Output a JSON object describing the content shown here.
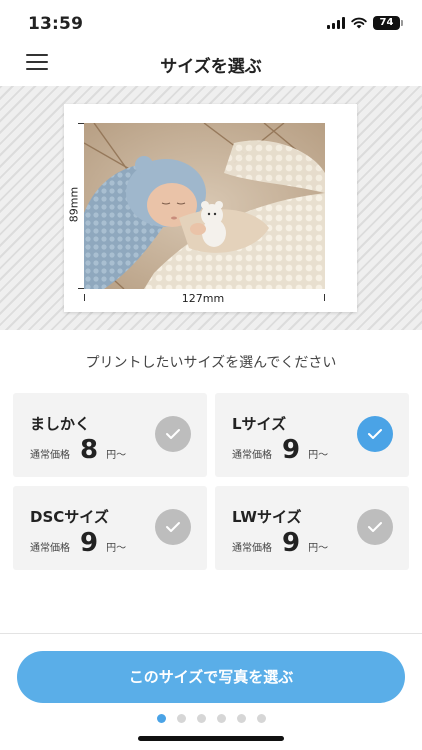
{
  "status_bar": {
    "time": "13:59",
    "battery": "74"
  },
  "nav": {
    "title": "サイズを選ぶ",
    "menu_icon": "hamburger-menu-icon"
  },
  "preview": {
    "width_label": "127mm",
    "height_label": "89mm",
    "photo_subject": "sleeping baby photo"
  },
  "instruction": "プリントしたいサイズを選んでください",
  "sizes": [
    {
      "name": "ましかく",
      "price_prefix": "通常価格",
      "price": "8",
      "price_suffix": "円〜",
      "selected": false
    },
    {
      "name": "Lサイズ",
      "price_prefix": "通常価格",
      "price": "9",
      "price_suffix": "円〜",
      "selected": true
    },
    {
      "name": "DSCサイズ",
      "price_prefix": "通常価格",
      "price": "9",
      "price_suffix": "円〜",
      "selected": false
    },
    {
      "name": "LWサイズ",
      "price_prefix": "通常価格",
      "price": "9",
      "price_suffix": "円〜",
      "selected": false
    }
  ],
  "cta": {
    "label": "このサイズで写真を選ぶ"
  },
  "pagination": {
    "total": 6,
    "current": 1
  },
  "colors": {
    "accent": "#4aa3e6",
    "cta": "#5aaee8",
    "unselected_check": "#bdbdbd",
    "card_bg": "#f3f3f3"
  }
}
